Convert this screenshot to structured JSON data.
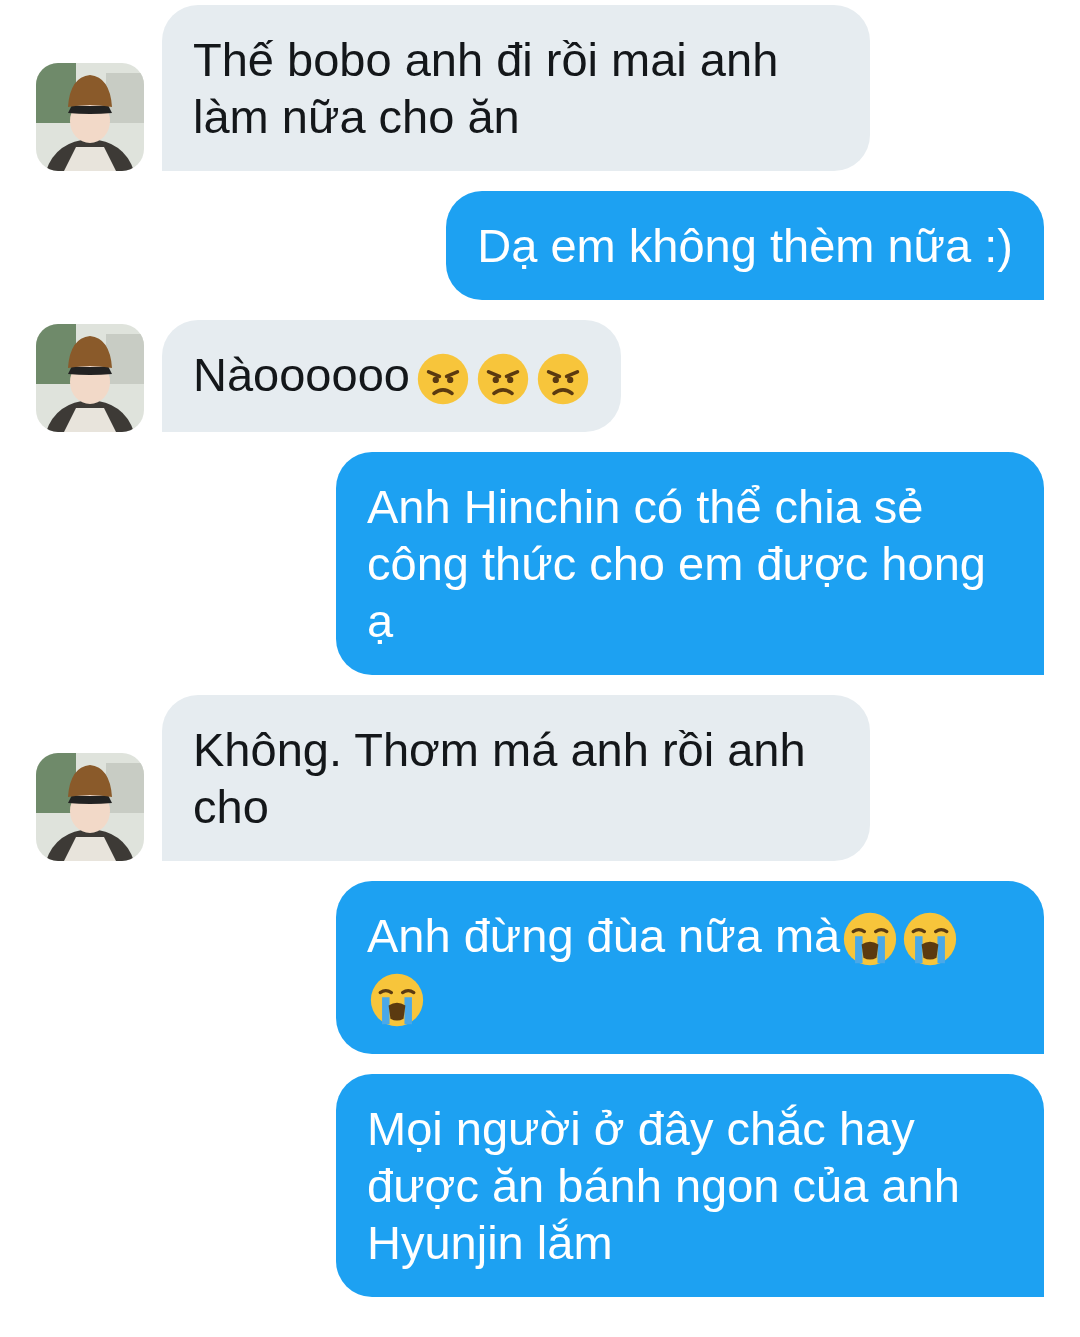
{
  "messages": [
    {
      "kind": "received",
      "text": "Thế bobo anh đi rồi mai anh làm nữa cho ăn"
    },
    {
      "kind": "sent",
      "text": "Dạ em không thèm nữa :)"
    },
    {
      "kind": "received",
      "text": "Nàoooooo",
      "emojis": [
        {
          "kind": "angry"
        },
        {
          "kind": "angry"
        },
        {
          "kind": "angry"
        }
      ]
    },
    {
      "kind": "sent",
      "text": "Anh Hinchin có thể chia sẻ công thức cho em được hong ạ"
    },
    {
      "kind": "received",
      "text": "Không. Thơm má anh rồi anh cho"
    },
    {
      "kind": "sent",
      "text": "Anh đừng đùa nữa mà",
      "emojis": [
        {
          "kind": "crying"
        },
        {
          "kind": "crying"
        },
        {
          "kind": "crying"
        }
      ]
    },
    {
      "kind": "sent",
      "text": "Mọi người ở đây chắc hay được ăn bánh ngon của anh Hyunjin lắm"
    }
  ]
}
